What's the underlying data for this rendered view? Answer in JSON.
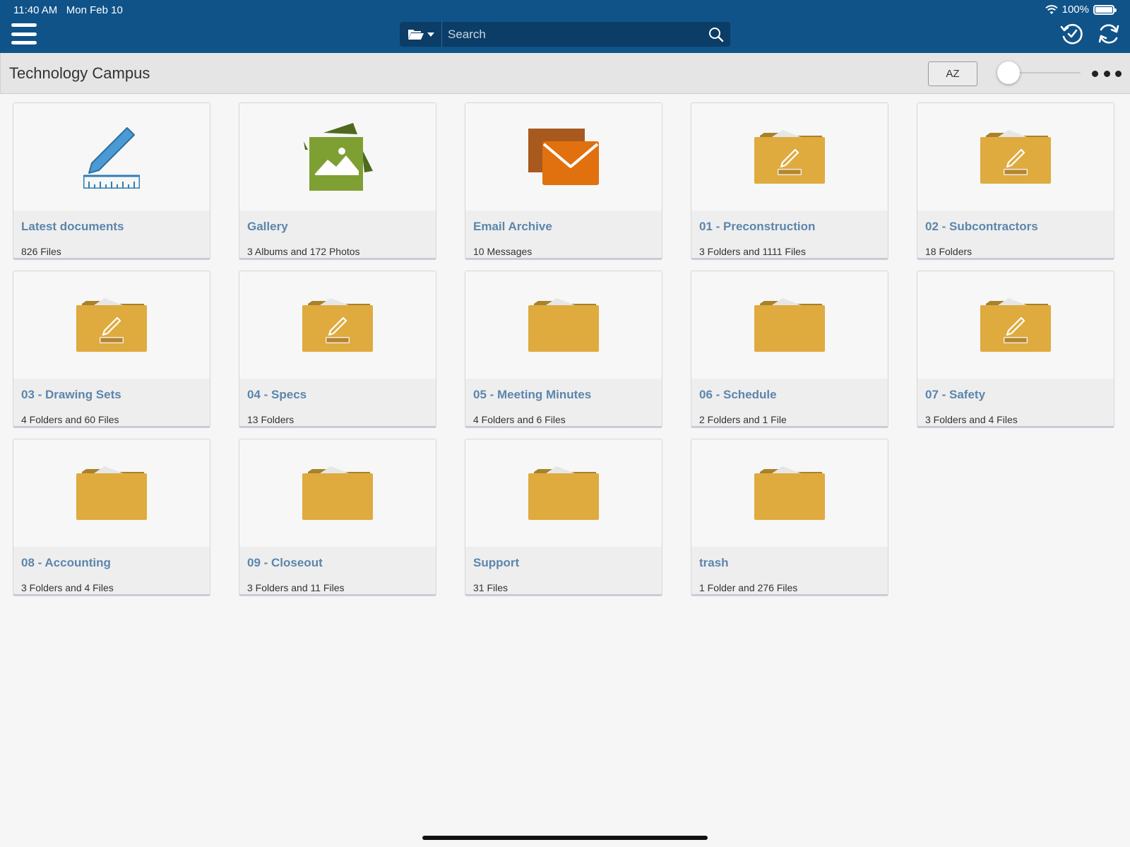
{
  "status_bar": {
    "time": "11:40 AM",
    "date": "Mon Feb 10",
    "battery": "100%"
  },
  "search": {
    "placeholder": "Search"
  },
  "header": {
    "title": "Technology Campus",
    "sort_label": "AZ"
  },
  "colors": {
    "topbar": "#0f5389",
    "folder": "#dfab3f",
    "link": "#5b86ad",
    "email": "#e1700e",
    "gallery": "#7ea033"
  },
  "tiles": [
    {
      "name": "Latest documents",
      "meta": "826 Files",
      "icon": "pencil-ruler-icon"
    },
    {
      "name": "Gallery",
      "meta": "3 Albums and 172 Photos",
      "icon": "gallery-icon"
    },
    {
      "name": "Email Archive",
      "meta": "10 Messages",
      "icon": "envelope-icon"
    },
    {
      "name": "01 - Preconstruction",
      "meta": "3 Folders and 1111 Files",
      "icon": "folder-edit-icon"
    },
    {
      "name": "02 - Subcontractors",
      "meta": "18 Folders",
      "icon": "folder-edit-icon"
    },
    {
      "name": "03 - Drawing Sets",
      "meta": "4 Folders and 60 Files",
      "icon": "folder-edit-icon"
    },
    {
      "name": "04 - Specs",
      "meta": "13 Folders",
      "icon": "folder-edit-icon"
    },
    {
      "name": "05 - Meeting Minutes",
      "meta": "4 Folders and 6 Files",
      "icon": "folder-icon"
    },
    {
      "name": "06 - Schedule",
      "meta": "2 Folders and 1 File",
      "icon": "folder-icon"
    },
    {
      "name": "07 - Safety",
      "meta": "3 Folders and 4 Files",
      "icon": "folder-edit-icon"
    },
    {
      "name": "08 - Accounting",
      "meta": "3 Folders and 4 Files",
      "icon": "folder-icon"
    },
    {
      "name": "09 - Closeout",
      "meta": "3 Folders and 11 Files",
      "icon": "folder-icon"
    },
    {
      "name": "Support",
      "meta": "31 Files",
      "icon": "folder-icon"
    },
    {
      "name": "trash",
      "meta": "1 Folder and 276 Files",
      "icon": "folder-icon"
    }
  ]
}
